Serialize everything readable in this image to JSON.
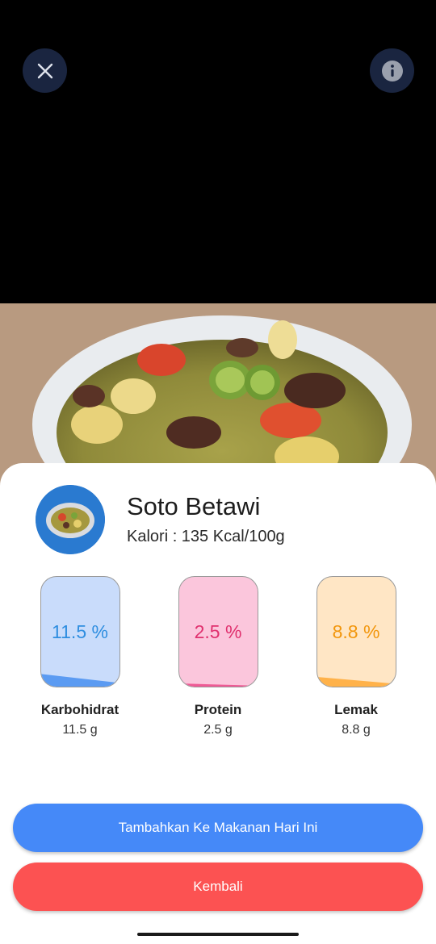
{
  "food": {
    "name": "Soto Betawi",
    "calories": "Kalori : 135 Kcal/100g"
  },
  "nutrients": [
    {
      "label": "Karbohidrat",
      "percent_text": "11.5 %",
      "amount": "11.5 g",
      "percent": 11.5,
      "color": "#2f8ee0",
      "bg": "#c9dcfb",
      "fill": "#5b9bf2"
    },
    {
      "label": "Protein",
      "percent_text": "2.5 %",
      "amount": "2.5 g",
      "percent": 2.5,
      "color": "#e0306e",
      "bg": "#fbc6dc",
      "fill": "#ee5a95"
    },
    {
      "label": "Lemak",
      "percent_text": "8.8 %",
      "amount": "8.8 g",
      "percent": 8.8,
      "color": "#f2960c",
      "bg": "#ffe6c5",
      "fill": "#ffb24a"
    }
  ],
  "actions": {
    "add_label": "Tambahkan Ke Makanan Hari Ini",
    "back_label": "Kembali"
  },
  "icons": {
    "close": "close-icon",
    "info": "info-icon"
  }
}
